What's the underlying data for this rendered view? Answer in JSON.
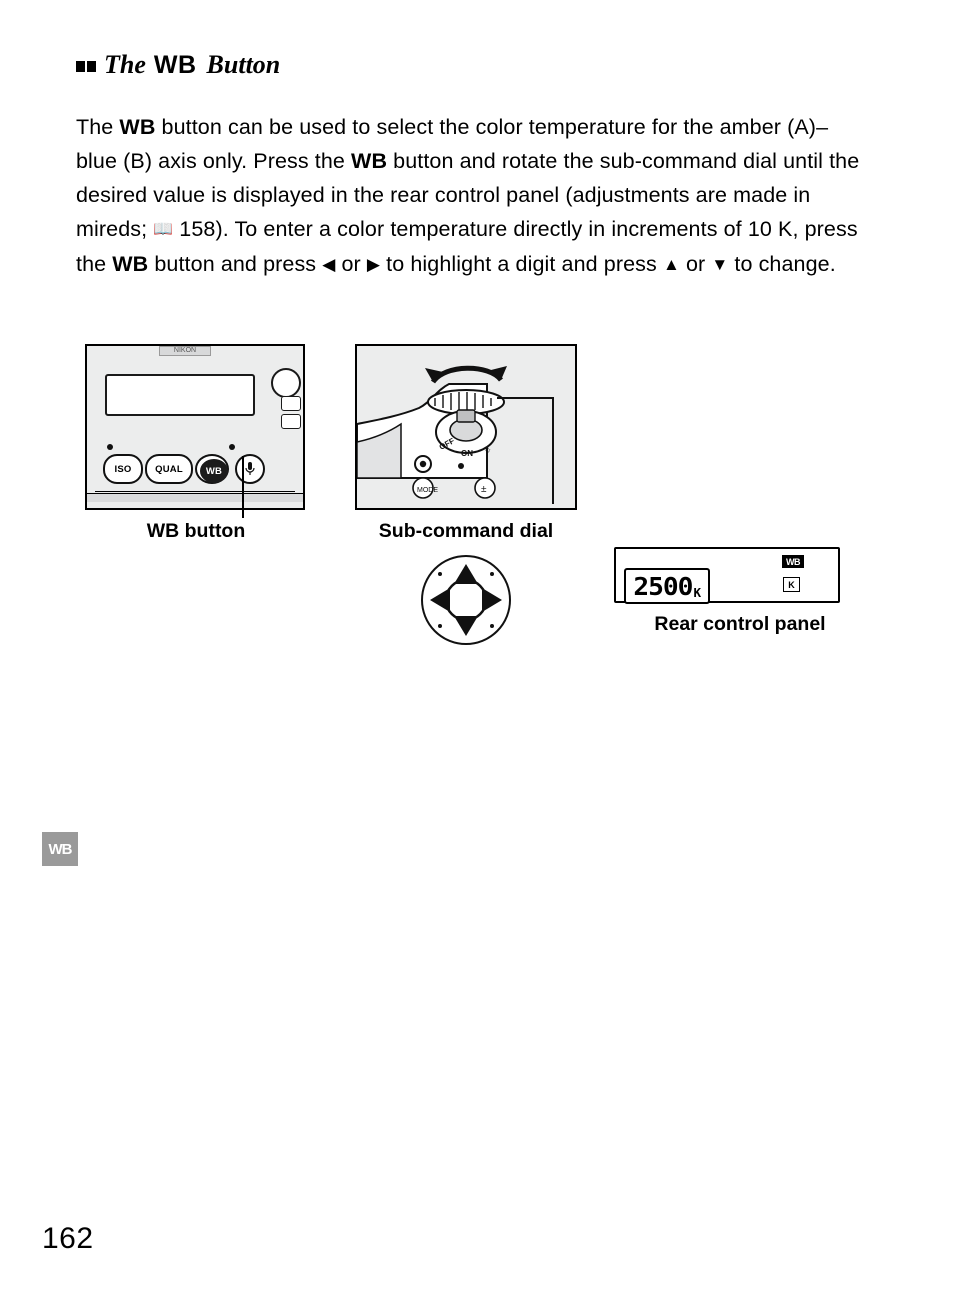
{
  "heading": {
    "the": "The",
    "wb": "WB",
    "button": "Button"
  },
  "body": {
    "p1_a": "The ",
    "p1_wb1": "WB",
    "p1_b": " button can be used to select the color temperature for the amber (A)–blue (B) axis only.  Press the ",
    "p1_wb2": "WB",
    "p1_c": " button and rotate the sub-command dial until the desired value is displayed in the rear control panel (adjustments are made in mireds; ",
    "p1_ref": "158",
    "p1_d": ").  To enter a color temperature directly in increments of 10 K, press the ",
    "p1_wb3": "WB",
    "p1_e": " button and press ",
    "arrow_left": "◀",
    "p1_f": " or ",
    "arrow_right": "▶",
    "p1_g": " to highlight a digit and press ",
    "arrow_up": "▲",
    "p1_h": " or ",
    "arrow_down": "▼",
    "p1_i": " to change."
  },
  "figures": {
    "camera_top": {
      "brand": "NIKON",
      "buttons": [
        "ISO",
        "QUAL",
        "WB"
      ],
      "caption": "WB button"
    },
    "sub_command_dial": {
      "caption": "Sub-command dial",
      "power_off": "OFF",
      "power_on": "ON",
      "mode_label": "MODE",
      "exposure_label": "±"
    },
    "rear_panel": {
      "value": "2500",
      "value_unit": "K",
      "wb_badge": "WB",
      "k_badge": "K",
      "caption": "Rear control panel"
    }
  },
  "side_tab": {
    "label": "WB"
  },
  "page": {
    "number": "162"
  }
}
